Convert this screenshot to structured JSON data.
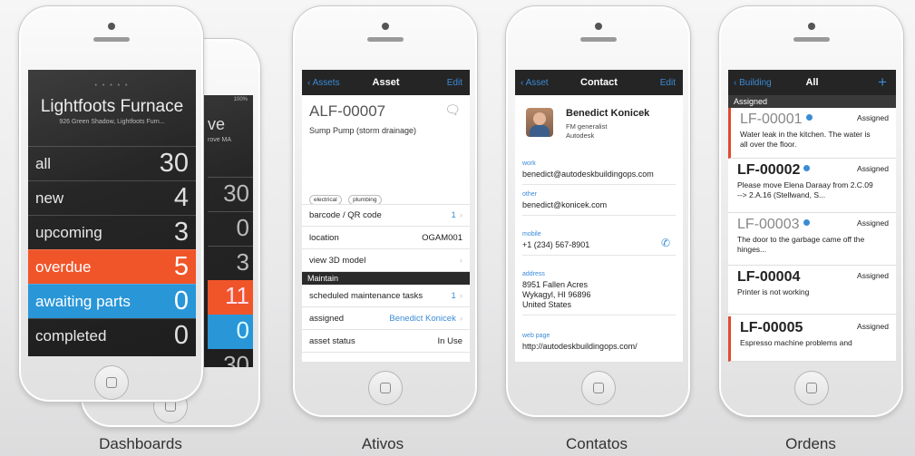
{
  "captions": [
    "Dashboards",
    "Ativos",
    "Contatos",
    "Ordens"
  ],
  "dashboard": {
    "title": "Lightfoots Furnace",
    "subtitle": "926 Green Shadow, Lightfoots Furn...",
    "rows": [
      {
        "label": "all",
        "value": "30"
      },
      {
        "label": "new",
        "value": "4"
      },
      {
        "label": "upcoming",
        "value": "3"
      },
      {
        "label": "overdue",
        "value": "5"
      },
      {
        "label": "awaiting parts",
        "value": "0"
      },
      {
        "label": "completed",
        "value": "0"
      }
    ],
    "back_phone": {
      "status": "100%",
      "title_frag": "ve",
      "sub_frag": "rove MA",
      "values": [
        "30",
        "0",
        "3",
        "11",
        "0",
        "30"
      ]
    },
    "accent_red": "#f0552a",
    "accent_blue": "#2996d8"
  },
  "asset": {
    "nav_back": "Assets",
    "nav_title": "Asset",
    "nav_edit": "Edit",
    "id": "ALF-00007",
    "name": "Sump Pump (storm drainage)",
    "tags": [
      "electrical",
      "plumbing"
    ],
    "cells": [
      {
        "label": "barcode / QR code",
        "value": "1"
      },
      {
        "label": "location",
        "value": "OGAM001"
      },
      {
        "label": "view 3D model",
        "value": ""
      }
    ],
    "section": "Maintain",
    "cells2": [
      {
        "label": "scheduled maintenance tasks",
        "value": "1"
      },
      {
        "label": "assigned",
        "value": "Benedict Konicek"
      },
      {
        "label": "asset status",
        "value": "In Use"
      }
    ]
  },
  "contact": {
    "nav_back": "Asset",
    "nav_title": "Contact",
    "nav_edit": "Edit",
    "name": "Benedict Konicek",
    "role": "FM generalist",
    "company": "Autodesk",
    "fields": [
      {
        "label": "work",
        "value": "benedict@autodeskbuildingops.com"
      },
      {
        "label": "other",
        "value": "benedict@konicek.com"
      },
      {
        "label": "mobile",
        "value": "+1 (234) 567-8901"
      },
      {
        "label": "address",
        "value": "8951 Fallen Acres\nWykagyl, HI 96896\nUnited States"
      },
      {
        "label": "web page",
        "value": "http://autodeskbuildingops.com/"
      }
    ]
  },
  "orders": {
    "nav_back": "Building",
    "nav_title": "All",
    "nav_plus": "+",
    "section": "Assigned",
    "items": [
      {
        "id": "LF-00001",
        "status": "Assigned",
        "desc": "Water leak in the kitchen. The water is all over the floor."
      },
      {
        "id": "LF-00002",
        "status": "Assigned",
        "desc": "Please move Elena Daraay from 2.C.09 --> 2.A.16 (Stellwand, S..."
      },
      {
        "id": "LF-00003",
        "status": "Assigned",
        "desc": "The door to the garbage came off the hinges..."
      },
      {
        "id": "LF-00004",
        "status": "Assigned",
        "desc": "Printer is not working"
      },
      {
        "id": "LF-00005",
        "status": "Assigned",
        "desc": "Espresso machine problems and"
      }
    ]
  }
}
